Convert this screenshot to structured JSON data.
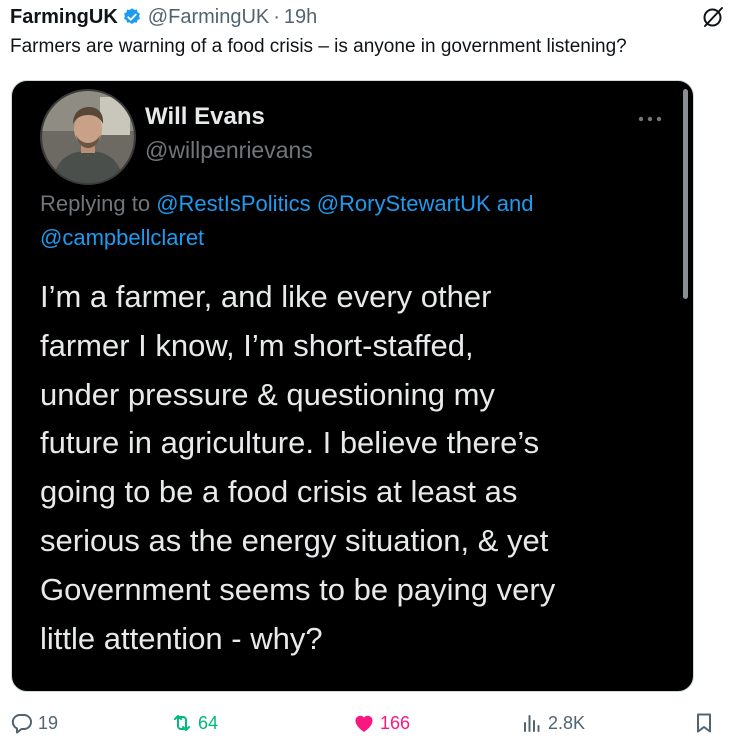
{
  "tweet": {
    "author_name": "FarmingUK",
    "handle": "@FarmingUK",
    "separator": "·",
    "time": "19h",
    "text": "Farmers are warning of a food crisis – is anyone in government listening?"
  },
  "embedded": {
    "name": "Will Evans",
    "handle": "@willpenrievans",
    "replying_prefix": "Replying to",
    "mention_1": "@RestIsPolitics",
    "mention_2": "@RoryStewartUK",
    "and": "and",
    "mention_3": "@campbellclaret",
    "lines": [
      "I’m a farmer, and like every other",
      "farmer I know, I’m short-staffed,",
      "under pressure & questioning my",
      "future in agriculture. I believe there’s",
      "going to be a food crisis at least as",
      "serious as the energy situation, & yet",
      "Government seems to be paying very",
      "little attention  - why?"
    ]
  },
  "actions": {
    "replies": "19",
    "retweets": "64",
    "likes": "166",
    "views": "2.8K"
  },
  "colors": {
    "verified": "#1d9bf0",
    "retweet": "#00ba7c",
    "like": "#f91880",
    "muted": "#536471"
  },
  "icons": [
    "verified-badge-icon",
    "grok-icon",
    "more-icon",
    "reply-icon",
    "retweet-icon",
    "heart-icon",
    "views-icon",
    "bookmark-icon"
  ]
}
